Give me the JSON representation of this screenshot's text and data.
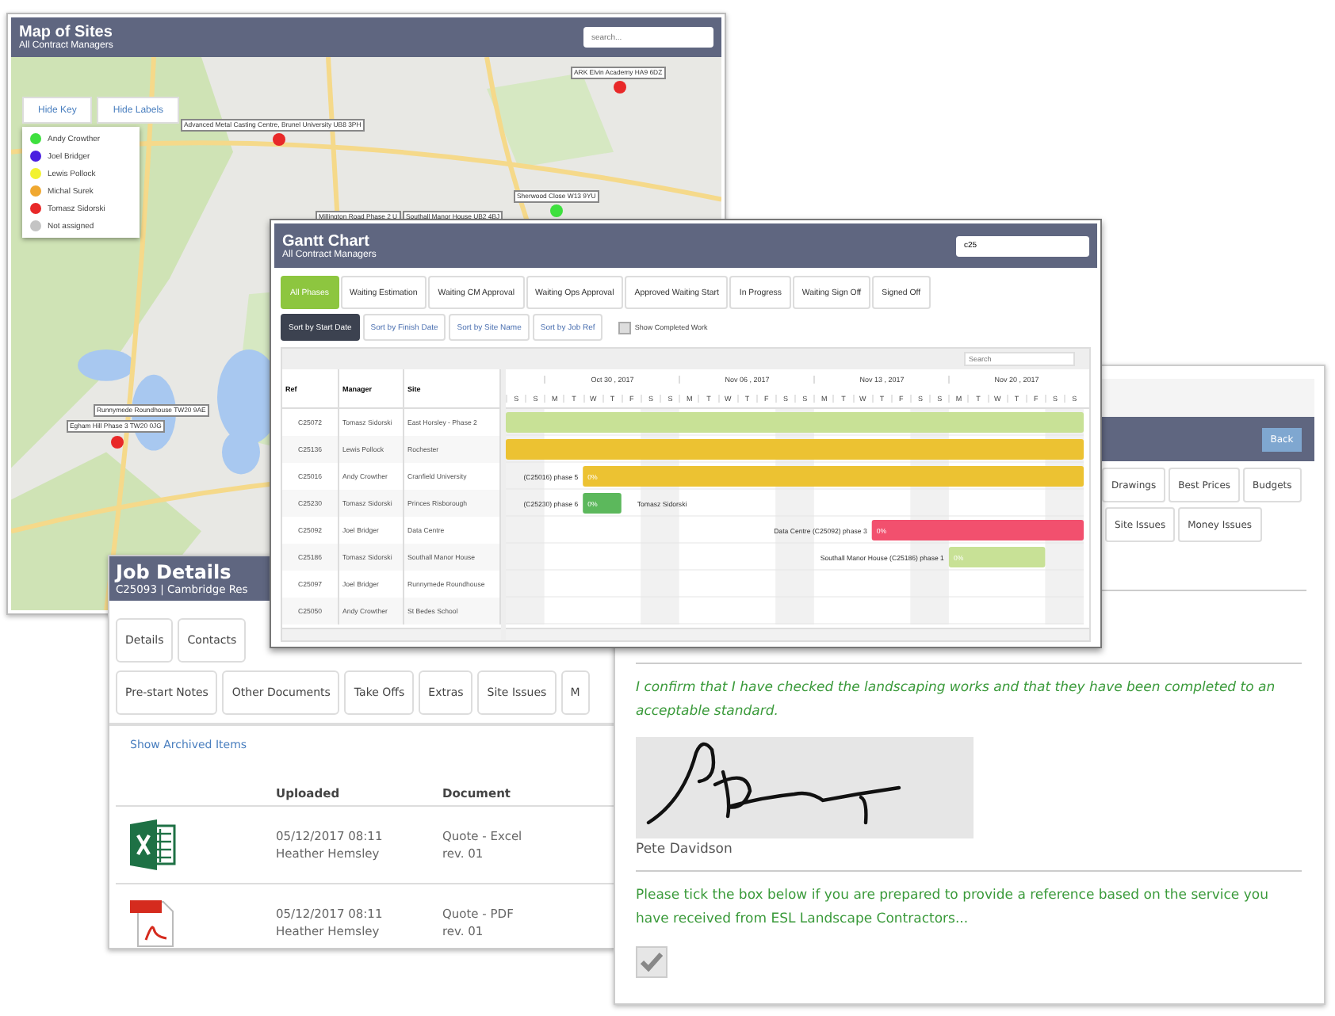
{
  "map_window": {
    "title": "Map of Sites",
    "subtitle": "All Contract Managers",
    "search": {
      "placeholder": "search..."
    },
    "buttons": [
      "Hide Key",
      "Hide Labels"
    ],
    "key": [
      {
        "name": "Andy Crowther",
        "color": "#3ee03e"
      },
      {
        "name": "Joel Bridger",
        "color": "#4a1fe0"
      },
      {
        "name": "Lewis Pollock",
        "color": "#f2f230"
      },
      {
        "name": "Michal Surek",
        "color": "#f0a830"
      },
      {
        "name": "Tomasz Sidorski",
        "color": "#e82828"
      },
      {
        "name": "Not assigned",
        "color": "#c4c4c4"
      }
    ],
    "sites": [
      {
        "label": "ARK Elvin Academy HA9 6DZ",
        "color": "#e82828"
      },
      {
        "label": "Advanced Metal Casting Centre, Brunel University UB8 3PH",
        "color": "#e82828"
      },
      {
        "label": "Sherwood Close W13 9YU",
        "color": "#3ee03e"
      },
      {
        "label": "Millington Road Phase 2 U"
      },
      {
        "label": "Southall Manor House UB2 4BJ"
      },
      {
        "label": "Runnymede Roundhouse TW20 9AE"
      },
      {
        "label": "Egham Hill Phase 3 TW20 0JG",
        "color": "#e82828"
      }
    ]
  },
  "gantt_window": {
    "title": "Gantt Chart",
    "subtitle": "All Contract Managers",
    "search": {
      "value": "c25"
    },
    "phase_tabs": [
      {
        "label": "All Phases",
        "selected": true
      },
      {
        "label": "Waiting Estimation",
        "selected": false
      },
      {
        "label": "Waiting CM Approval",
        "selected": false
      },
      {
        "label": "Waiting Ops Approval",
        "selected": false
      },
      {
        "label": "Approved Waiting Start",
        "selected": false
      },
      {
        "label": "In Progress",
        "selected": false
      },
      {
        "label": "Waiting Sign Off",
        "selected": false
      },
      {
        "label": "Signed Off",
        "selected": false
      }
    ],
    "sort_buttons": [
      {
        "label": "Sort by Start Date",
        "selected": true
      },
      {
        "label": "Sort by Finish Date",
        "selected": false
      },
      {
        "label": "Sort by Site Name",
        "selected": false
      },
      {
        "label": "Sort by Job Ref",
        "selected": false
      }
    ],
    "completed_checkbox": {
      "label": "Show Completed Work",
      "checked": false
    },
    "grid_search": {
      "placeholder": "Search"
    },
    "columns": [
      "Ref",
      "Manager",
      "Site"
    ],
    "weeks": [
      "Oct 30 , 2017",
      "Nov 06 , 2017",
      "Nov 13 , 2017",
      "Nov 20 , 2017"
    ],
    "days": [
      "S",
      "S",
      "M",
      "T",
      "W",
      "T",
      "F",
      "S",
      "S",
      "M",
      "T",
      "W",
      "T",
      "F",
      "S",
      "S",
      "M",
      "T",
      "W",
      "T",
      "F",
      "S",
      "S",
      "M",
      "T",
      "W",
      "T",
      "F",
      "S",
      "S"
    ],
    "rows": [
      {
        "ref": "C25072",
        "manager": "Tomasz Sidorski",
        "site": "East Horsley - Phase 2",
        "bar": {
          "color": "#c8e196"
        }
      },
      {
        "ref": "C25136",
        "manager": "Lewis Pollock",
        "site": "Rochester",
        "bar": {
          "color": "#ecc232"
        }
      },
      {
        "ref": "C25016",
        "manager": "Andy Crowther",
        "site": "Cranfield University",
        "bar": {
          "color": "#ecc232",
          "percent": "0%"
        },
        "caption": "(C25016) phase 5"
      },
      {
        "ref": "C25230",
        "manager": "Tomasz Sidorski",
        "site": "Princes Risborough",
        "bar": {
          "color": "#5cb85c",
          "percent": "0%"
        },
        "caption": "(C25230) phase 6",
        "after": "Tomasz Sidorski"
      },
      {
        "ref": "C25092",
        "manager": "Joel Bridger",
        "site": "Data Centre",
        "bar": {
          "color": "#f2506e",
          "percent": "0%"
        },
        "caption": "Data Centre (C25092) phase 3"
      },
      {
        "ref": "C25186",
        "manager": "Tomasz Sidorski",
        "site": "Southall Manor House",
        "bar": {
          "color": "#c8e196",
          "percent": "0%"
        },
        "caption": "Southall Manor House (C25186) phase 1"
      },
      {
        "ref": "C25097",
        "manager": "Joel Bridger",
        "site": "Runnymede Roundhouse"
      },
      {
        "ref": "C25050",
        "manager": "Andy Crowther",
        "site": "St Bedes School"
      }
    ]
  },
  "job_window": {
    "title": "Job Details",
    "subtitle": "C25093 | Cambridge Res",
    "tabs_row_1": [
      "Details",
      "Contacts"
    ],
    "tabs_row_2": [
      "Pre-start Notes",
      "Other Documents",
      "Take Offs",
      "Extras",
      "Site Issues",
      "M"
    ],
    "archived_link": "Show Archived Items",
    "columns": [
      "Uploaded",
      "Document"
    ],
    "documents": [
      {
        "kind": "excel",
        "date": "05/12/2017 08:11",
        "user": "Heather Hemsley",
        "name": "Quote - Excel",
        "revision": "rev. 01"
      },
      {
        "kind": "pdf",
        "date": "05/12/2017 08:11",
        "user": "Heather Hemsley",
        "name": "Quote - PDF",
        "revision": "rev. 01"
      }
    ]
  },
  "signoff_window": {
    "back_button": "Back",
    "tabs_row_1": [
      "Drawings",
      "Best Prices",
      "Budgets"
    ],
    "tabs_row_2": [
      "Site Issues",
      "Money Issues"
    ],
    "confirmation": "I confirm that I have checked the landscaping works and that they have been completed to an acceptable standard.",
    "signatory": "Pete Davidson",
    "reference_prompt": "Please tick the box below if you are prepared to provide a reference based on the service you have received from ESL Landscape Contractors...",
    "reference_checkbox": {
      "checked": true
    }
  }
}
